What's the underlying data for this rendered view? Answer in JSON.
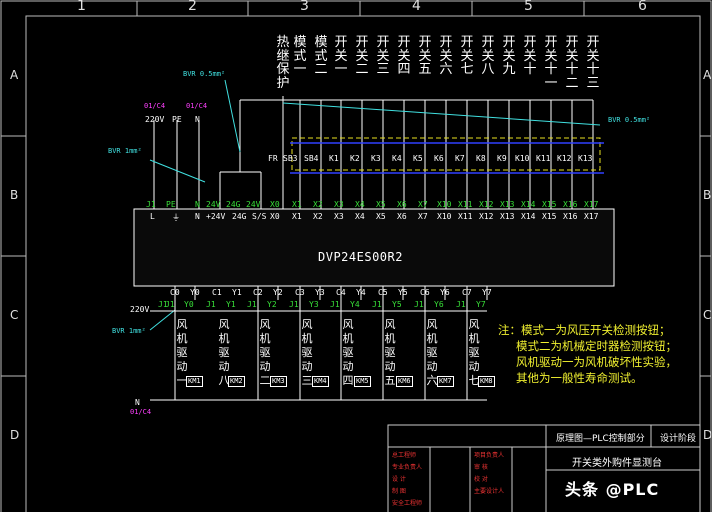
{
  "grid": {
    "numbers": [
      "1",
      "2",
      "3",
      "4",
      "5",
      "6"
    ],
    "letters": [
      "A",
      "B",
      "C",
      "D"
    ]
  },
  "top_labels": [
    "热继保护",
    "模式一",
    "模式二",
    "开关一",
    "开关二",
    "开关三",
    "开关四",
    "开关五",
    "开关六",
    "开关七",
    "开关八",
    "开关九",
    "开关十",
    "开关十一",
    "开关十二",
    "开关十三"
  ],
  "switch_labels": [
    "FR",
    "SB3",
    "SB4",
    "K1",
    "K2",
    "K3",
    "K4",
    "K5",
    "K6",
    "K7",
    "K8",
    "K9",
    "K10",
    "K11",
    "K12",
    "K13"
  ],
  "input_terms": [
    "X0",
    "X1",
    "X2",
    "X3",
    "X4",
    "X5",
    "X6",
    "X7",
    "X10",
    "X11",
    "X12",
    "X13",
    "X14",
    "X15",
    "X16",
    "X17"
  ],
  "power_terms": [
    "L",
    "⏚",
    "N",
    "+24V",
    "24G",
    "S/S"
  ],
  "power_top": [
    "J1",
    "PE",
    "N",
    "24V",
    "24G",
    "24V"
  ],
  "supply": {
    "v220": "220V",
    "pe": "PE",
    "n": "N",
    "tag1": "01/C4",
    "tag2": "01/C4"
  },
  "wires": {
    "bvr05_a": "BVR 0.5mm²",
    "bvr05_b": "BVR 0.5mm²",
    "bvr1_a": "BVR 1mm²",
    "bvr1_b": "BVR 1mm²"
  },
  "plc_model": "DVP24ES00R2",
  "out_common": [
    "C0",
    "Y0",
    "C1",
    "Y1",
    "C2",
    "Y2",
    "C3",
    "Y3",
    "C4",
    "Y4",
    "C5",
    "Y5",
    "C6",
    "Y6",
    "C7",
    "Y7"
  ],
  "out_j": [
    "J1",
    "Y0",
    "J1",
    "Y1",
    "J1",
    "Y2",
    "J1",
    "Y3",
    "J1",
    "Y4",
    "J1",
    "Y5",
    "J1",
    "Y6",
    "J1",
    "Y7"
  ],
  "out_supply": {
    "v": "220V",
    "j": "J1",
    "n": "N",
    "tag": "01/C4"
  },
  "fans": [
    "风机驱动一",
    "风机驱动二",
    "风机驱动三",
    "风机驱动四",
    "风机驱动五",
    "风机驱动六",
    "风机驱动七",
    "风机驱动八"
  ],
  "km": [
    "KM1",
    "KM2",
    "KM3",
    "KM4",
    "KM5",
    "KM6",
    "KM7",
    "KM8"
  ],
  "note": [
    "注：模式一为风压开关检测按钮；",
    "模式二为机械定时器检测按钮；",
    "风机驱动一为风机破坏性实验，",
    "其他为一般性寿命测试。"
  ],
  "title_block": {
    "drawing_name": "原理图—PLC控制部分",
    "stage": "设计阶段",
    "project": "开关类外购件显测台",
    "rows": [
      "总工程师",
      "项目负责人",
      "审 核",
      "校 对",
      "设 计",
      "制 图",
      "专业负责人",
      "安全工程师",
      "主要设计人"
    ]
  },
  "watermark": "头条 @PLC"
}
